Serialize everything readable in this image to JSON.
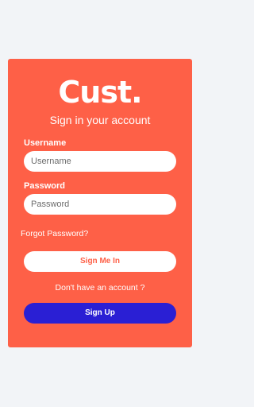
{
  "login": {
    "logo": "Cust.",
    "subtitle": "Sign in your account",
    "username_label": "Username",
    "username_placeholder": "Username",
    "password_label": "Password",
    "password_placeholder": "Password",
    "forgot_password": "Forgot Password?",
    "sign_in_button": "Sign Me In",
    "no_account_text": "Don't have an account ?",
    "sign_up_button": "Sign Up"
  },
  "colors": {
    "background": "#f2f4f7",
    "card": "#fe6047",
    "primary_button": "#2a1fd4",
    "text_on_card": "#ffffff"
  }
}
